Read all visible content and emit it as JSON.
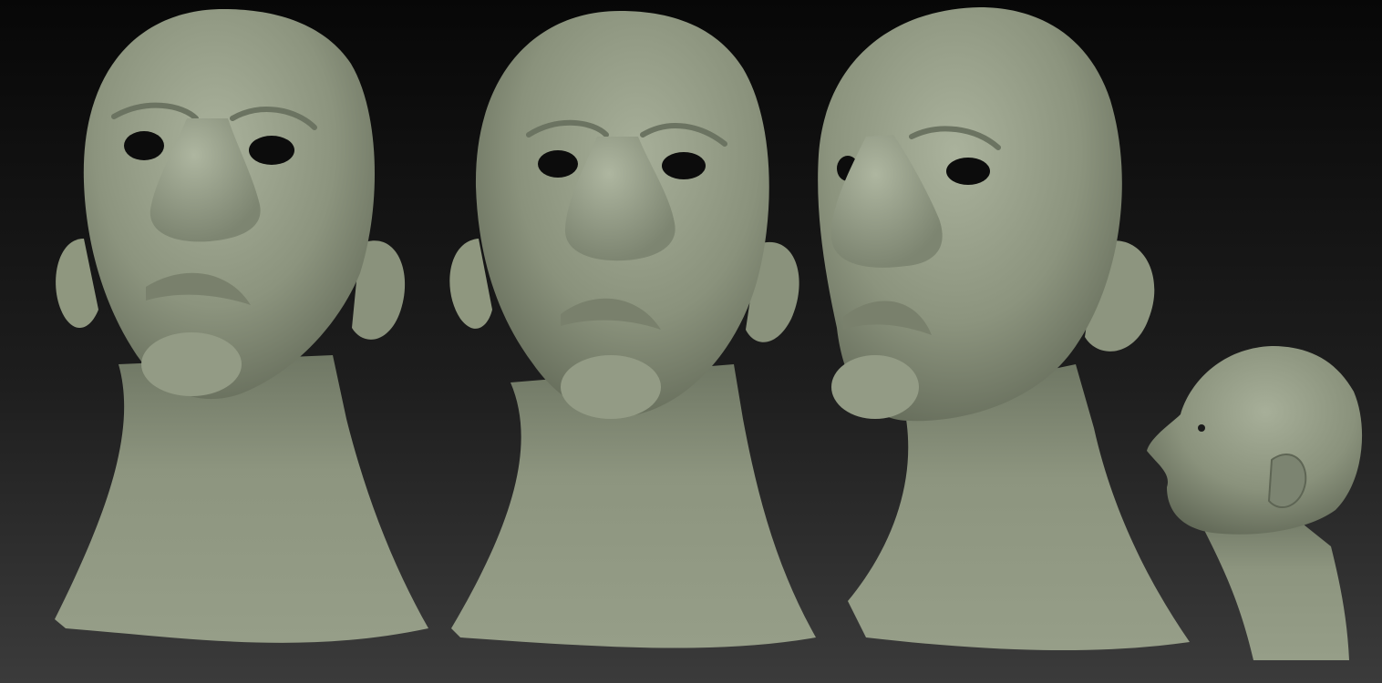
{
  "scene": {
    "subject": "sculpted-head-render",
    "views": [
      "front",
      "three-quarter-front",
      "three-quarter-left",
      "profile-small"
    ],
    "colors": {
      "background_top": "#0a0a0a",
      "background_bottom": "#3a3a3a",
      "clay_light": "#a3ab95",
      "clay_mid": "#8a927c",
      "clay_dark": "#5c6352",
      "clay_shadow": "#3f4538"
    }
  }
}
